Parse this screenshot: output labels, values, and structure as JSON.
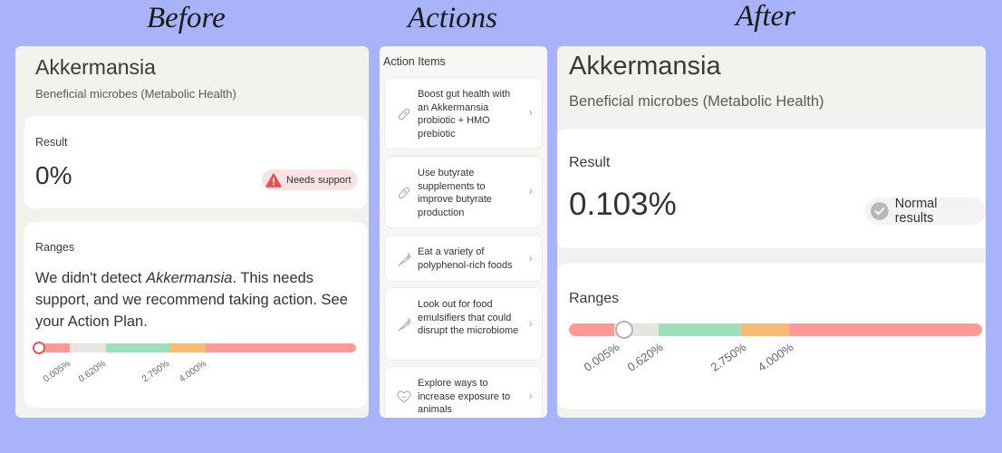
{
  "headings": {
    "before": "Before",
    "actions": "Actions",
    "after": "After"
  },
  "before": {
    "title": "Akkermansia",
    "subtitle": "Beneficial microbes (Metabolic Health)",
    "result_label": "Result",
    "result_value": "0%",
    "badge": "Needs support",
    "ranges_label": "Ranges",
    "ranges_text_1": "We didn't detect ",
    "ranges_text_em": "Akkermansia",
    "ranges_text_2": ". This needs support, and we recommend taking action. See your Action Plan.",
    "ticks": [
      "0.005%",
      "0.620%",
      "2.750%",
      "4.000%"
    ],
    "marker_position_fraction": 0.0
  },
  "actions": {
    "title": "Action Items",
    "items": [
      {
        "label": "Boost gut health with an Akkermansia probiotic + HMO prebiotic",
        "icon": "pill-icon"
      },
      {
        "label": "Use butyrate supplements to improve butyrate production",
        "icon": "pill-icon"
      },
      {
        "label": "Eat a variety of polyphenol-rich foods",
        "icon": "carrot-icon"
      },
      {
        "label": "Look out for food emulsifiers that could disrupt the microbiome",
        "icon": "carrot-icon"
      },
      {
        "label": "Explore ways to increase exposure to animals",
        "icon": "heart-icon"
      }
    ]
  },
  "after": {
    "title": "Akkermansia",
    "subtitle": "Beneficial microbes (Metabolic Health)",
    "result_label": "Result",
    "result_value": "0.103%",
    "badge": "Normal results",
    "ranges_label": "Ranges",
    "ticks": [
      "0.005%",
      "0.620%",
      "2.750%",
      "4.000%"
    ],
    "marker_position_fraction": 0.13
  },
  "colors": {
    "background": "#a8b3f9",
    "range_red": "#fd9a98",
    "range_gray": "#e6e5e1",
    "range_green": "#9edfbc",
    "range_orange": "#f7bb76",
    "warn_icon": "#e05252",
    "ok_icon": "#b8b8b8"
  }
}
